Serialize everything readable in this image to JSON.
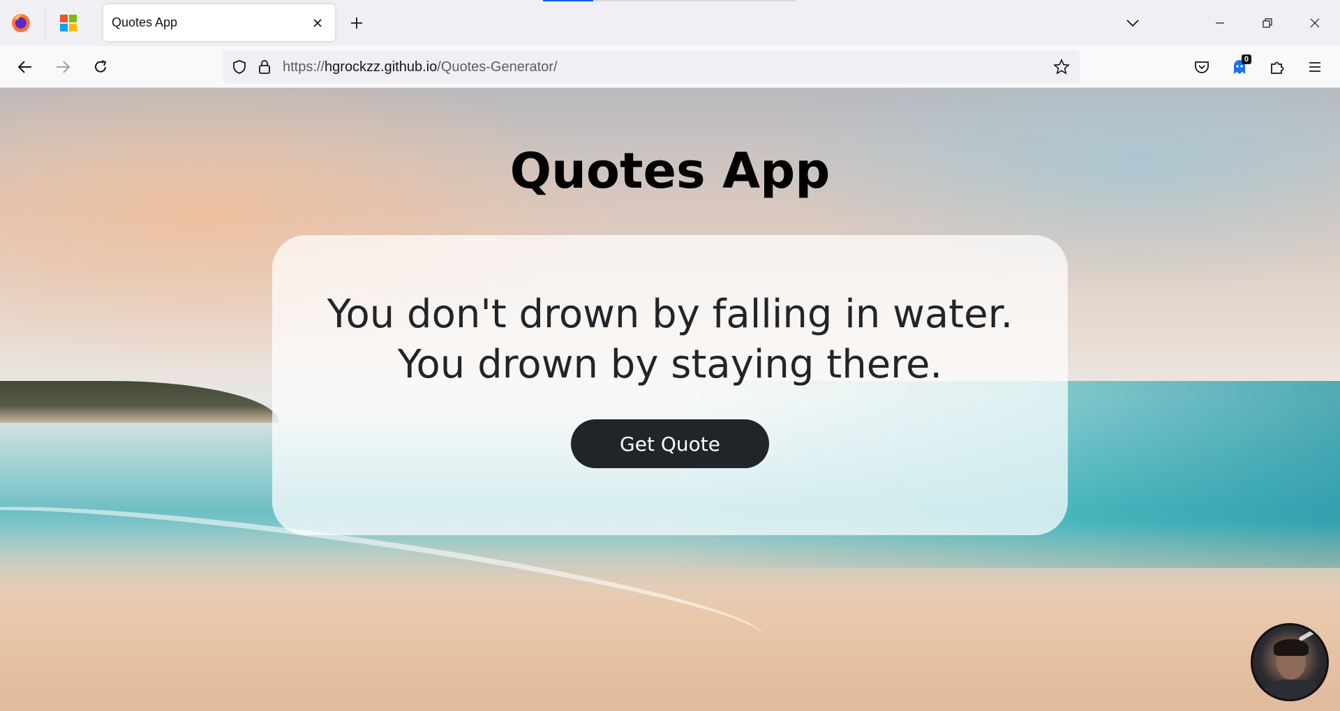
{
  "browser": {
    "tab": {
      "title": "Quotes App"
    },
    "url": {
      "scheme": "https://",
      "host": "hgrockzz.github.io",
      "path": "/Quotes-Generator/"
    },
    "toolbar": {
      "extension_badge": "0"
    },
    "icons": {
      "app_menu": "firefox-icon",
      "pinned": "microsoft-logo-icon",
      "new_tab": "plus-icon",
      "list_tabs": "chevron-down-icon",
      "back": "arrow-left-icon",
      "forward": "arrow-right-icon",
      "reload": "reload-icon",
      "tracking": "shield-icon",
      "lock": "lock-icon",
      "bookmark": "star-icon",
      "pocket": "pocket-icon",
      "extension": "ghost-extension-icon",
      "extensions": "puzzle-icon",
      "menu": "hamburger-icon"
    }
  },
  "page": {
    "title": "Quotes App",
    "quote_line1": "You don't drown by falling in water.",
    "quote_line2": "You drown by staying there.",
    "button_label": "Get Quote"
  },
  "colors": {
    "button_bg": "#212529",
    "button_text": "#ffffff",
    "card_bg": "rgba(255,255,255,0.72)",
    "accent": "#0060df"
  }
}
